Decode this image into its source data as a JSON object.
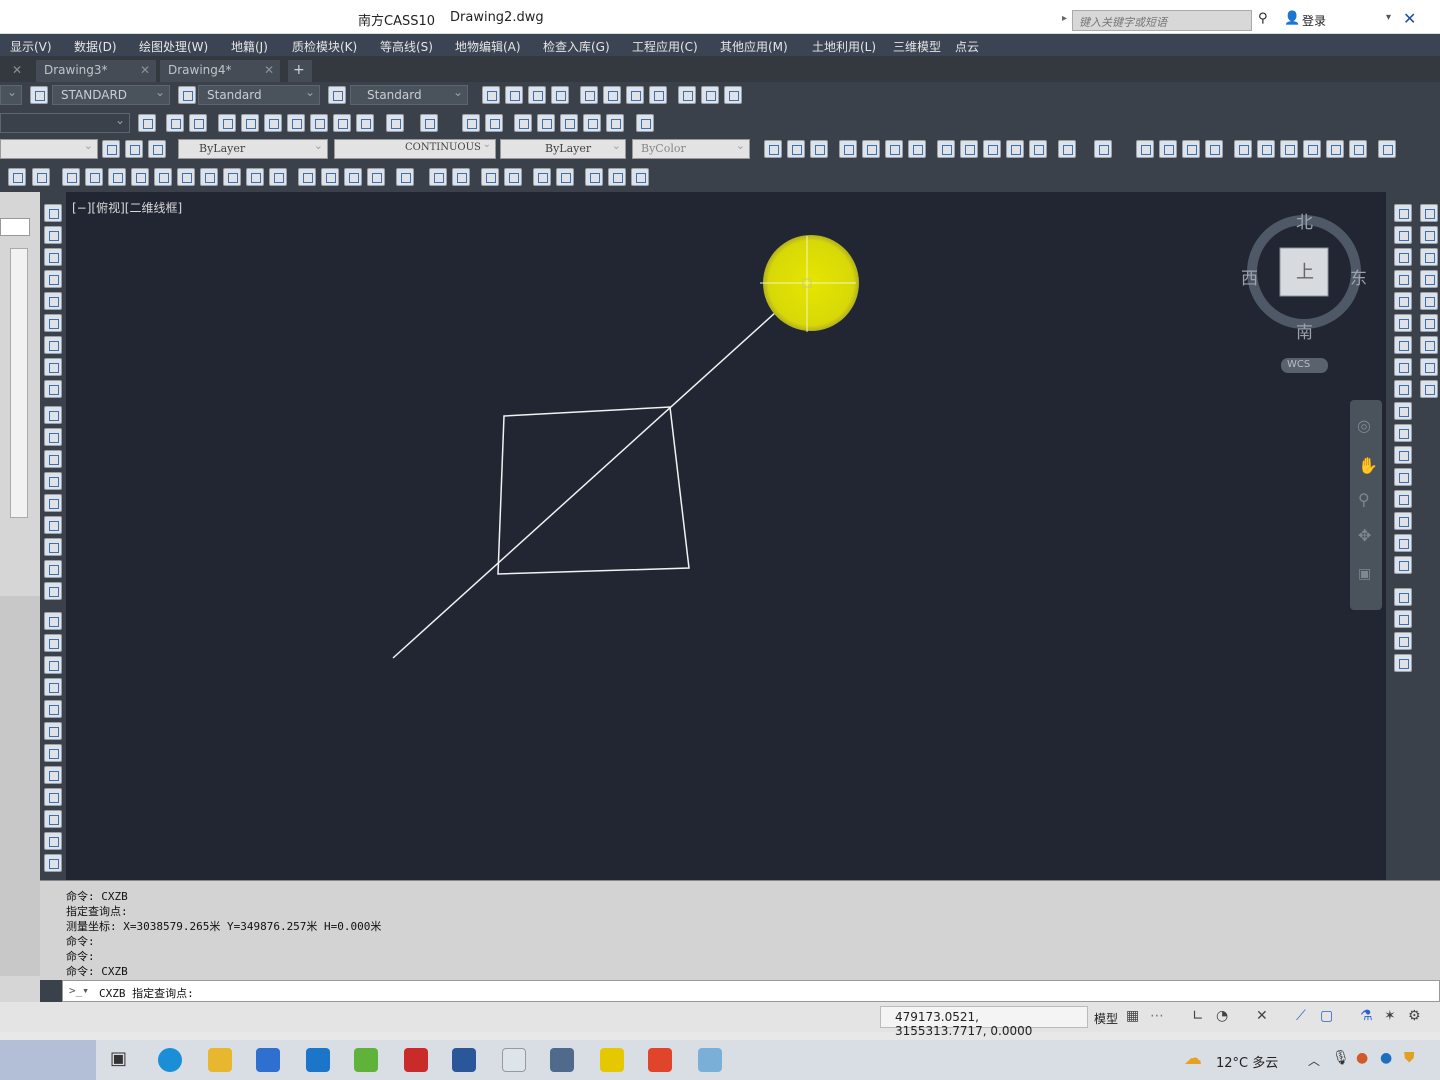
{
  "title": {
    "app": "南方CASS10",
    "doc": "Drawing2.dwg",
    "search_placeholder": "键入关键字或短语",
    "login": "登录"
  },
  "menu": [
    "显示(V)",
    "数据(D)",
    "绘图处理(W)",
    "地籍(J)",
    "质检模块(K)",
    "等高线(S)",
    "地物编辑(A)",
    "检查入库(G)",
    "工程应用(C)",
    "其他应用(M)",
    "土地利用(L)",
    "三维模型",
    "点云"
  ],
  "tabs": [
    "Drawing3*",
    "Drawing4*"
  ],
  "toolbar": {
    "textstyle": "STANDARD",
    "dimstyle": "Standard",
    "tablestyle": "Standard",
    "layer": "ByLayer",
    "linetype": "CONTINUOUS",
    "lineweight": "ByLayer",
    "plotstyle": "ByColor"
  },
  "viewport": {
    "label": "[−][俯视][二维线框]"
  },
  "viewcube": {
    "north": "北",
    "south": "南",
    "east": "东",
    "west": "西",
    "top": "上",
    "wcs": "WCS"
  },
  "command": {
    "lines": [
      "命令: CXZB",
      "指定查询点:",
      "测量坐标: X=3038579.265米   Y=349876.257米   H=0.000米",
      "命令:",
      "命令:",
      "命令: CXZB"
    ],
    "prompt": "CXZB 指定查询点:"
  },
  "status": {
    "coords": "479173.0521, 3155313.7717, 0.0000",
    "model": "模型"
  },
  "taskbar": {
    "weather": "12°C 多云"
  },
  "colors": {
    "canvas": "#212632",
    "highlight": "#e6e600"
  }
}
